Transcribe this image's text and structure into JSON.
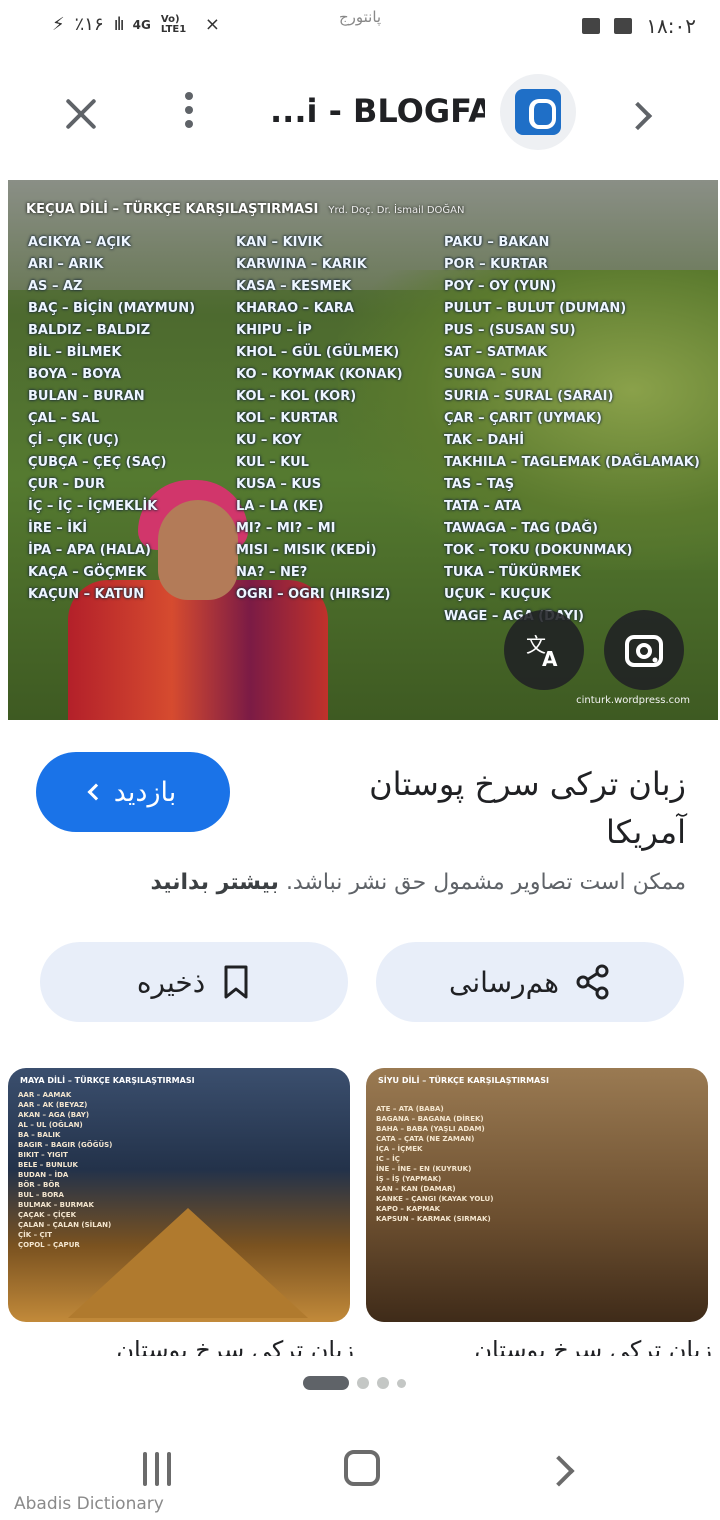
{
  "status_bar": {
    "battery": "٪۱۶",
    "network": "4G",
    "lte": "Vo) LTE1",
    "carrier_center": "پانتورج",
    "time": "۱۸:۰۲"
  },
  "header": {
    "site_title": "...i - BLOGFA"
  },
  "main_image": {
    "heading": "KEÇUA DİLİ – TÜRKÇE KARŞILAŞTIRMASI",
    "author": "Yrd. Doç. Dr. İsmail DOĞAN",
    "columns": [
      [
        "ACIKYA – AÇIK",
        "ARI – ARIK",
        "AS – AZ",
        "BAÇ – BİÇİN (MAYMUN)",
        "BALDIZ – BALDIZ",
        "BİL – BİLMEK",
        "BOYA – BOYA",
        "BULAN – BURAN",
        "ÇAL – SAL",
        "Çİ – ÇIK (UÇ)",
        "ÇUBÇA – ÇEÇ (SAÇ)",
        "ÇUR – DUR",
        "İÇ – İÇ – İÇMEKLİK",
        "İRE – İKİ",
        "İPA – APA (HALA)",
        "KAÇA – GÖÇMEK",
        "KAÇUN – KATUN"
      ],
      [
        "KAN – KIVIK",
        "KARWINA – KARIK",
        "KASA – KESMEK",
        "KHARAO – KARA",
        "KHIPU – İP",
        "KHOL – GÜL (GÜLMEK)",
        "KO – KOYMAK (KONAK)",
        "KOL – KOL (KOR)",
        "KOL – KURTAR",
        "KU – KOY",
        "KUL – KUL",
        "KUSA – KUS",
        "LA – LA (KE)",
        "MI? – MI? – MI",
        "MISI – MISIK (KEDİ)",
        "NA? – NE?",
        "OGRI – OGRI (HIRSIZ)"
      ],
      [
        "PAKU – BAKAN",
        "POR – KURTAR",
        "POY – OY (YUN)",
        "PULUT – BULUT (DUMAN)",
        "PUS – (SUSAN SU)",
        "SAT – SATMAK",
        "SUNGA – SUN",
        "SURIA – SURAL (SARAI)",
        "ÇAR – ÇARIT (UYMAK)",
        "TAK – DAHİ",
        "TAKHILA – TAGLEMAK (DAĞLAMAK)",
        "TAS – TAŞ",
        "TATA – ATA",
        "TAWAGA – TAG (DAĞ)",
        "TOK – TOKU (DOKUNMAK)",
        "TUKA – TÜKÜRMEK",
        "UÇUK – KUÇUK",
        "WAGE – AGA (DAYI)"
      ]
    ],
    "watermark": "cinturk.wordpress.com",
    "translate_icon": "translate-icon",
    "lens_icon": "lens-icon"
  },
  "result": {
    "visit_label": "بازدید",
    "title": "زبان ترکی سرخ پوستان آمریکا",
    "copyright_text": "ممکن است تصاویر مشمول حق نشر نباشد.",
    "learn_more": "بیشتر بدانید",
    "share_label": "هم‌رسانی",
    "save_label": "ذخیره"
  },
  "related": [
    {
      "heading": "MAYA DİLİ – TÜRKÇE KARŞILAŞTIRMASI",
      "title": "زبان ترکی سرخ پوستان",
      "lines": "AAR – AAMAK\nAAR – AK (BEYAZ)\nAKAN – AGA (BAY)\nAL – UL (OĞLAN)\nBA – BALIK\nBAGIR – BAGIR (GÖĞÜS)\nBIKIT – YIGIT\nBELE – BUNLUK\nBUDAN – İDA\nBÖR – BÖR\nBUL – BORA\nBULMAK – BURMAK\nÇAÇAK – ÇİÇEK\nÇALAN – ÇALAN (SİLAN)\nÇİK – ÇIT\nÇOPOL – ÇAPUR"
    },
    {
      "heading": "SİYU DİLİ – TÜRKÇE KARŞILAŞTIRMASI",
      "title": "زبان ترکی سرخ پوستان",
      "lines": "ATE – ATA (BABA)\nBAGANA – BAGANA (DİREK)\nBAHA – BABA (YAŞLI ADAM)\nCATA – ÇATA (NE ZAMAN)\nİÇA – İÇMEK\nIC – İÇ\nİNE – İNE – EN (KUYRUK)\nİŞ – İŞ (YAPMAK)\nKAN – KAN (DAMAR)\nKANKE – ÇANGI (KAYAK YOLU)\nKAPO – KAPMAK\nKAPSUN – KARMAK (SIRMAK)"
    }
  ],
  "pager": {
    "active_index": 0,
    "count": 4
  },
  "app_watermark": "Abadis Dictionary"
}
